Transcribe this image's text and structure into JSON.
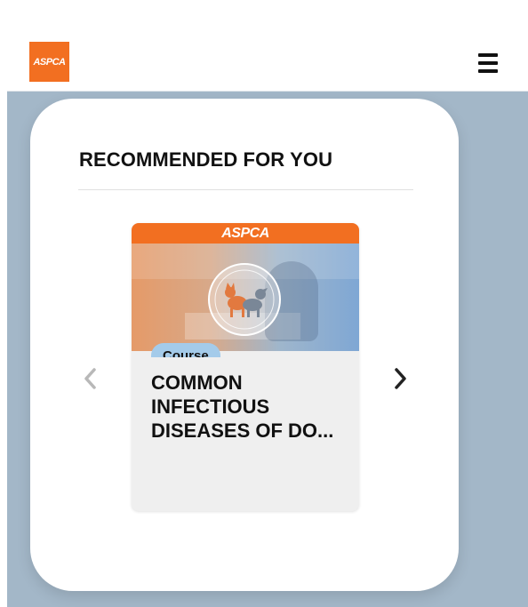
{
  "header": {
    "logo_text": "ASPCA",
    "menu_icon": "hamburger-menu-icon",
    "brand_color": "#f26f21"
  },
  "recommended": {
    "title": "RECOMMENDED FOR YOU",
    "prev_icon": "chevron-left-icon",
    "next_icon": "chevron-right-icon",
    "course": {
      "banner_text": "ASPCA",
      "title": "COMMON INFECTIOUS DISEASES OF DO...",
      "type_badge": "Course"
    }
  },
  "colors": {
    "page_background": "#a3b7c8",
    "accent": "#f26f21",
    "badge": "#a4cbea"
  }
}
